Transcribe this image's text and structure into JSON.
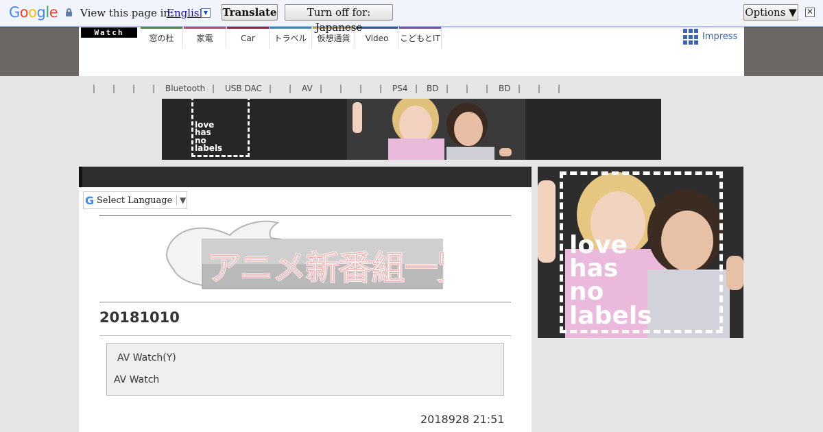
{
  "translate_bar": {
    "logo_letters": [
      {
        "ch": "G",
        "color": "#4285f4"
      },
      {
        "ch": "o",
        "color": "#ea4335"
      },
      {
        "ch": "o",
        "color": "#fbbc05"
      },
      {
        "ch": "g",
        "color": "#4285f4"
      },
      {
        "ch": "l",
        "color": "#34a853"
      },
      {
        "ch": "e",
        "color": "#ea4335"
      }
    ],
    "prompt": "View this page in:",
    "language": "English",
    "translate_button": "Translate",
    "turn_off_button": "Turn off for: Japanese",
    "options_button": "Options ▼",
    "close_symbol": "✕"
  },
  "header": {
    "logo": "Watch",
    "nav_tabs": [
      {
        "label": "窓の杜",
        "color": "#5aa23c"
      },
      {
        "label": "家電",
        "color": "#e0507a"
      },
      {
        "label": "Car",
        "color": "#c0204a"
      },
      {
        "label": "トラベル",
        "color": "#3ca0d8"
      },
      {
        "label": "仮想通貨",
        "color": "#e0b040"
      },
      {
        "label": "Video",
        "color": "#3b64b4"
      },
      {
        "label": "こどもとIT",
        "color": "#8a5cc0"
      }
    ],
    "impress_label": "Impress"
  },
  "keywords": [
    "Bluetooth",
    "USB DAC",
    "AV",
    "PS4",
    "BD",
    "BD"
  ],
  "banner": {
    "text_lines": [
      "love",
      "has",
      "no",
      "labels"
    ]
  },
  "main": {
    "language_select": "Select Language",
    "language_select_arrow": "▼",
    "logo_text": "アニメ新番組一覧",
    "date_title": "20181010",
    "info_line_1": "AV Watch(Y)",
    "info_line_2": "AV Watch",
    "post_date": "2018928 21:51"
  },
  "side_ad": {
    "text_lines": [
      "love",
      "has",
      "no",
      "labels"
    ]
  }
}
